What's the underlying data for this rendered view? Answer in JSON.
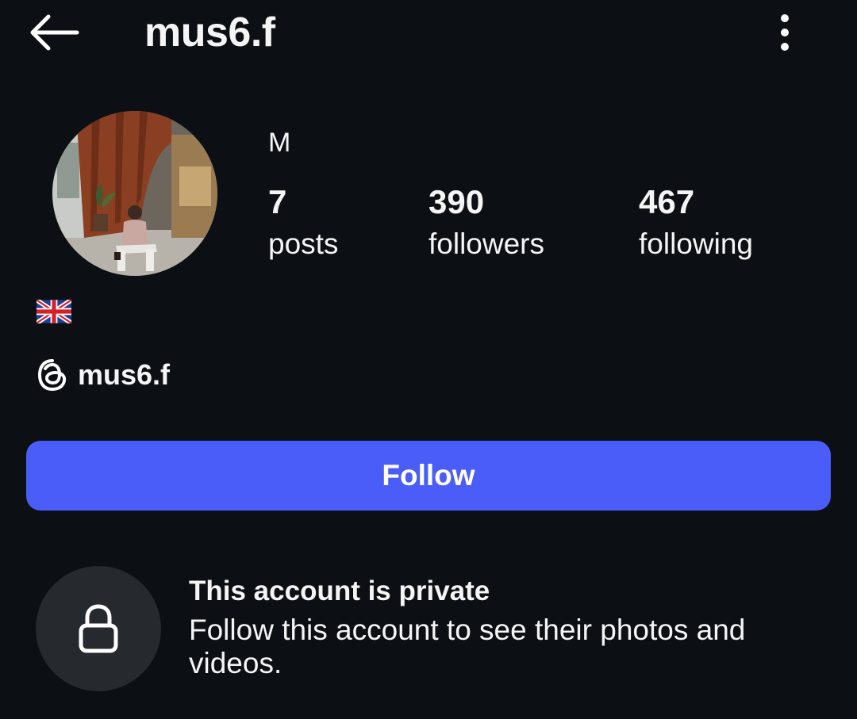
{
  "header": {
    "username": "mus6.f",
    "back_icon": "arrow-left-icon",
    "more_icon": "more-vertical-icon"
  },
  "profile": {
    "display_name": "M",
    "flag_icon": "uk-flag-icon",
    "stats": {
      "posts": {
        "value": "7",
        "label": "posts"
      },
      "followers": {
        "value": "390",
        "label": "followers"
      },
      "following": {
        "value": "467",
        "label": "following"
      }
    },
    "threads": {
      "icon": "threads-icon",
      "handle": "mus6.f"
    }
  },
  "actions": {
    "follow_label": "Follow"
  },
  "private_notice": {
    "icon": "lock-icon",
    "title": "This account is private",
    "description": "Follow this account to see their photos and videos."
  },
  "colors": {
    "background": "#0c1014",
    "follow_button": "#4a5df9",
    "lock_circle": "#26292d",
    "text": "#f5f5f5"
  }
}
